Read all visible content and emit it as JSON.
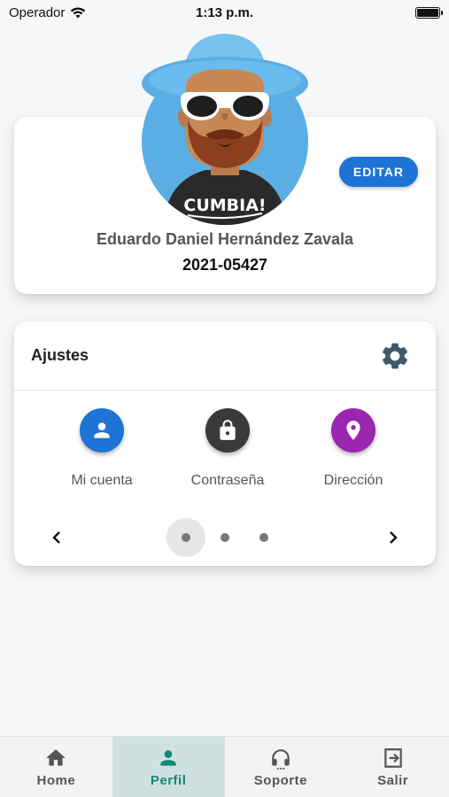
{
  "status_bar": {
    "carrier": "Operador",
    "time": "1:13 p.m."
  },
  "profile": {
    "edit_label": "EDITAR",
    "name": "Eduardo Daniel Hernández Zavala",
    "student_id": "2021-05427",
    "avatar_shirt_text": "CUMBIA!"
  },
  "settings": {
    "title": "Ajustes",
    "options": [
      {
        "label": "Mi cuenta",
        "icon": "person-icon",
        "color": "#1e73d6"
      },
      {
        "label": "Contraseña",
        "icon": "lock-icon",
        "color": "#3a3a3a"
      },
      {
        "label": "Dirección",
        "icon": "location-pin-icon",
        "color": "#9b27b0"
      }
    ],
    "pager": {
      "pages": 3,
      "active": 1
    }
  },
  "nav": {
    "items": [
      {
        "label": "Home",
        "icon": "home-icon"
      },
      {
        "label": "Perfil",
        "icon": "person-icon"
      },
      {
        "label": "Soporte",
        "icon": "headset-icon"
      },
      {
        "label": "Salir",
        "icon": "logout-icon"
      }
    ],
    "active": "Perfil"
  },
  "colors": {
    "primary": "#1e73d6",
    "nav_active_bg": "#cfe1df",
    "nav_active_fg": "#0f8a77"
  }
}
